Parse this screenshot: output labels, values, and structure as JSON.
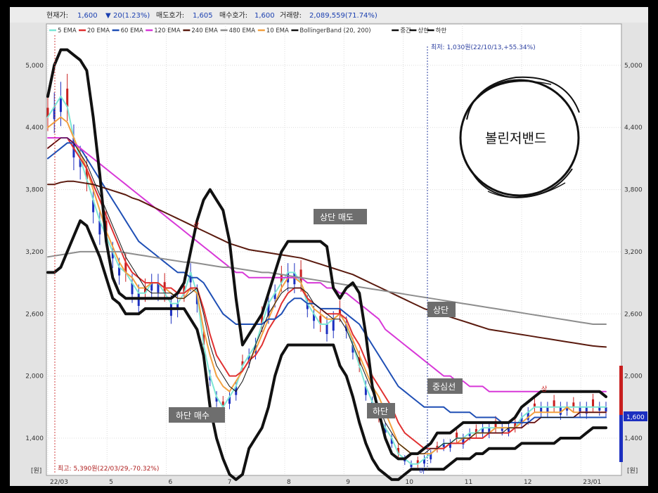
{
  "header": {
    "price_label": "현재가:",
    "price_value": "1,600",
    "change_value": "20(1.23%)",
    "ask_label": "매도호가:",
    "ask_value": "1,605",
    "bid_label": "매수호가:",
    "bid_value": "1,600",
    "volume_label": "거래량:",
    "volume_value": "2,089,559(71.74%)"
  },
  "legend": [
    {
      "name": "5 EMA",
      "color": "#7de7d6"
    },
    {
      "name": "20 EMA",
      "color": "#e03030"
    },
    {
      "name": "60 EMA",
      "color": "#1f4fb5"
    },
    {
      "name": "120 EMA",
      "color": "#d838d8"
    },
    {
      "name": "240 EMA",
      "color": "#5a1a0e"
    },
    {
      "name": "480 EMA",
      "color": "#8d8d8d"
    },
    {
      "name": "10 EMA",
      "color": "#f2a040"
    },
    {
      "name": "BollingerBand (20, 200)",
      "color": "#111111"
    },
    {
      "name": "중간",
      "color": "#111111"
    },
    {
      "name": "상한",
      "color": "#111111"
    },
    {
      "name": "하한",
      "color": "#111111"
    }
  ],
  "annotations": {
    "low_label": "최저: 1,030원(22/10/13,+55.34%)",
    "high_label": "최고: 5,390원(22/03/29,-70.32%)",
    "upper_sell": "상단 매도",
    "lower_buy": "하단 매수",
    "upper": "상단",
    "lower": "하단",
    "centerline": "중심선",
    "badge": "볼린저밴드",
    "current_price_tag": "1,600",
    "unit_left": "[원]",
    "unit_right": "[원]",
    "peak_marker": "상",
    "trough_marker": "하"
  },
  "chart_data": {
    "type": "line",
    "title": "",
    "x_ticks": [
      "22/03",
      "5",
      "6",
      "7",
      "8",
      "9",
      "10",
      "11",
      "12",
      "23/01"
    ],
    "y_ticks": [
      1400,
      2000,
      2600,
      3200,
      3800,
      4400,
      5000
    ],
    "y_tick_labels": [
      "1,400",
      "2,000",
      "2,600",
      "3,200",
      "3,800",
      "4,400",
      "5,000"
    ],
    "ylim": [
      1040,
      5400
    ],
    "x": [
      0,
      0.5,
      1,
      1.5,
      2,
      2.5,
      3,
      3.5,
      4,
      4.5,
      5,
      5.5,
      6,
      6.5,
      7,
      7.5,
      8,
      8.5,
      9,
      9.5,
      10,
      10.5,
      11,
      11.5,
      12,
      12.5,
      13,
      13.5,
      14,
      14.5,
      15,
      15.5,
      16,
      16.5,
      17,
      17.5,
      18,
      18.5,
      19,
      19.5,
      20,
      20.5,
      21,
      21.5,
      22,
      22.5,
      23,
      23.5,
      24,
      24.5,
      25,
      25.5,
      26,
      26.5,
      27,
      27.5,
      28,
      28.5,
      29,
      29.5,
      30,
      30.5,
      31,
      31.5,
      32,
      32.5,
      33,
      33.5,
      34,
      34.5,
      35,
      35.5,
      36,
      36.5,
      37,
      37.5,
      38,
      38.5,
      39,
      39.5,
      40,
      40.5,
      41,
      41.5,
      42,
      42.5,
      43
    ],
    "grid": true,
    "series": [
      {
        "name": "5 EMA",
        "color": "#7de7d6",
        "values": [
          4500,
          4600,
          4700,
          4600,
          4300,
          4100,
          3900,
          3700,
          3500,
          3350,
          3200,
          3050,
          3000,
          2900,
          2800,
          2800,
          2900,
          2900,
          2800,
          2700,
          2700,
          2800,
          3000,
          2800,
          2300,
          2000,
          1800,
          1700,
          1800,
          1900,
          2100,
          2200,
          2300,
          2500,
          2700,
          2800,
          2900,
          3000,
          3000,
          2900,
          2700,
          2600,
          2500,
          2500,
          2550,
          2600,
          2500,
          2300,
          2100,
          1900,
          1750,
          1600,
          1500,
          1400,
          1250,
          1200,
          1150,
          1150,
          1200,
          1250,
          1300,
          1350,
          1350,
          1400,
          1400,
          1450,
          1450,
          1500,
          1500,
          1500,
          1500,
          1500,
          1500,
          1600,
          1650,
          1700,
          1700,
          1700,
          1700,
          1700,
          1700,
          1700,
          1700,
          1700,
          1700,
          1700,
          1700
        ]
      },
      {
        "name": "10 EMA",
        "color": "#f2a040",
        "values": [
          4400,
          4450,
          4500,
          4450,
          4300,
          4150,
          4000,
          3800,
          3600,
          3400,
          3250,
          3100,
          3000,
          2950,
          2850,
          2850,
          2900,
          2900,
          2850,
          2800,
          2750,
          2750,
          2850,
          2800,
          2450,
          2200,
          2000,
          1900,
          1850,
          1950,
          2050,
          2150,
          2250,
          2400,
          2550,
          2700,
          2850,
          2950,
          2950,
          2900,
          2750,
          2650,
          2600,
          2550,
          2550,
          2600,
          2500,
          2350,
          2200,
          2050,
          1900,
          1800,
          1650,
          1500,
          1350,
          1300,
          1250,
          1250,
          1250,
          1250,
          1300,
          1300,
          1350,
          1350,
          1400,
          1400,
          1450,
          1450,
          1450,
          1500,
          1500,
          1500,
          1500,
          1550,
          1600,
          1650,
          1650,
          1650,
          1650,
          1650,
          1700,
          1650,
          1650,
          1650,
          1650,
          1650,
          1650
        ]
      },
      {
        "name": "20 EMA",
        "color": "#e03030",
        "values": [
          4200,
          4250,
          4300,
          4300,
          4200,
          4100,
          4000,
          3850,
          3700,
          3550,
          3400,
          3250,
          3100,
          3000,
          2950,
          2900,
          2900,
          2900,
          2850,
          2850,
          2800,
          2800,
          2850,
          2850,
          2650,
          2400,
          2200,
          2100,
          2000,
          2000,
          2050,
          2150,
          2200,
          2300,
          2450,
          2550,
          2700,
          2800,
          2850,
          2850,
          2750,
          2700,
          2650,
          2600,
          2600,
          2600,
          2550,
          2400,
          2300,
          2150,
          2000,
          1900,
          1800,
          1700,
          1550,
          1450,
          1400,
          1350,
          1300,
          1300,
          1300,
          1300,
          1350,
          1350,
          1350,
          1400,
          1400,
          1400,
          1450,
          1450,
          1450,
          1450,
          1500,
          1500,
          1550,
          1550,
          1600,
          1600,
          1600,
          1600,
          1600,
          1600,
          1650,
          1650,
          1650,
          1650,
          1650
        ]
      },
      {
        "name": "60 EMA",
        "color": "#1f4fb5",
        "values": [
          4100,
          4150,
          4200,
          4250,
          4250,
          4200,
          4100,
          4000,
          3900,
          3800,
          3700,
          3600,
          3500,
          3400,
          3300,
          3250,
          3200,
          3150,
          3100,
          3050,
          3000,
          3000,
          2950,
          2950,
          2900,
          2800,
          2700,
          2600,
          2550,
          2500,
          2500,
          2500,
          2500,
          2500,
          2550,
          2550,
          2600,
          2700,
          2750,
          2750,
          2700,
          2700,
          2650,
          2650,
          2650,
          2650,
          2600,
          2550,
          2500,
          2400,
          2300,
          2200,
          2100,
          2000,
          1900,
          1850,
          1800,
          1750,
          1700,
          1700,
          1700,
          1700,
          1650,
          1650,
          1650,
          1650,
          1600,
          1600,
          1600,
          1600,
          1550,
          1550,
          1550,
          1550,
          1550,
          1600,
          1600,
          1600,
          1600,
          1600,
          1600,
          1600,
          1600,
          1600,
          1600,
          1600,
          1600
        ]
      },
      {
        "name": "120 EMA",
        "color": "#d838d8",
        "values": [
          4300,
          4300,
          4300,
          4300,
          4250,
          4200,
          4150,
          4100,
          4050,
          4000,
          3950,
          3900,
          3850,
          3800,
          3750,
          3700,
          3650,
          3600,
          3550,
          3500,
          3450,
          3400,
          3350,
          3300,
          3250,
          3200,
          3150,
          3100,
          3050,
          3000,
          3000,
          2950,
          2950,
          2950,
          2950,
          2950,
          2950,
          2950,
          2950,
          2950,
          2900,
          2900,
          2900,
          2850,
          2850,
          2800,
          2800,
          2750,
          2700,
          2650,
          2600,
          2550,
          2450,
          2400,
          2350,
          2300,
          2250,
          2200,
          2150,
          2100,
          2050,
          2000,
          2000,
          1950,
          1950,
          1900,
          1900,
          1900,
          1850,
          1850,
          1850,
          1850,
          1850,
          1850,
          1850,
          1850,
          1850,
          1850,
          1850,
          1850,
          1850,
          1850,
          1850,
          1850,
          1850,
          1850,
          1850
        ]
      },
      {
        "name": "240 EMA",
        "color": "#5a1a0e",
        "values": [
          3850,
          3850,
          3870,
          3880,
          3880,
          3870,
          3860,
          3850,
          3830,
          3810,
          3790,
          3770,
          3750,
          3720,
          3700,
          3670,
          3640,
          3610,
          3580,
          3550,
          3520,
          3490,
          3460,
          3430,
          3400,
          3370,
          3340,
          3310,
          3280,
          3260,
          3240,
          3220,
          3210,
          3200,
          3190,
          3180,
          3170,
          3160,
          3150,
          3140,
          3120,
          3100,
          3080,
          3060,
          3040,
          3020,
          3000,
          2980,
          2950,
          2920,
          2890,
          2860,
          2830,
          2800,
          2770,
          2740,
          2710,
          2680,
          2650,
          2630,
          2610,
          2590,
          2570,
          2550,
          2530,
          2510,
          2490,
          2470,
          2450,
          2440,
          2430,
          2420,
          2410,
          2400,
          2390,
          2380,
          2370,
          2360,
          2350,
          2340,
          2330,
          2320,
          2310,
          2300,
          2290,
          2285,
          2280
        ]
      },
      {
        "name": "480 EMA",
        "color": "#8d8d8d",
        "values": [
          3150,
          3160,
          3170,
          3180,
          3190,
          3200,
          3200,
          3200,
          3200,
          3200,
          3200,
          3200,
          3190,
          3180,
          3170,
          3160,
          3150,
          3140,
          3130,
          3120,
          3110,
          3100,
          3100,
          3090,
          3080,
          3070,
          3060,
          3050,
          3050,
          3040,
          3030,
          3020,
          3010,
          3000,
          3000,
          2990,
          2980,
          2970,
          2960,
          2950,
          2940,
          2930,
          2920,
          2910,
          2900,
          2890,
          2880,
          2870,
          2860,
          2850,
          2840,
          2830,
          2820,
          2810,
          2800,
          2790,
          2780,
          2770,
          2760,
          2750,
          2740,
          2730,
          2720,
          2710,
          2700,
          2690,
          2680,
          2670,
          2660,
          2650,
          2640,
          2630,
          2620,
          2610,
          2600,
          2590,
          2580,
          2570,
          2560,
          2550,
          2540,
          2530,
          2520,
          2510,
          2500,
          2500,
          2500
        ]
      },
      {
        "name": "중간",
        "color": "#111111",
        "values": [
          4200,
          4250,
          4300,
          4300,
          4250,
          4150,
          4050,
          3900,
          3750,
          3600,
          3450,
          3300,
          3150,
          3050,
          2950,
          2850,
          2800,
          2800,
          2800,
          2800,
          2750,
          2750,
          2800,
          2850,
          2600,
          2300,
          2100,
          2000,
          1900,
          1850,
          1950,
          2100,
          2300,
          2450,
          2600,
          2700,
          2800,
          2850,
          2850,
          2850,
          2800,
          2700,
          2650,
          2600,
          2550,
          2550,
          2450,
          2300,
          2150,
          2000,
          1850,
          1700,
          1550,
          1450,
          1350,
          1300,
          1250,
          1250,
          1250,
          1300,
          1300,
          1350,
          1350,
          1400,
          1400,
          1400,
          1450,
          1450,
          1450,
          1450,
          1450,
          1500,
          1500,
          1500,
          1550,
          1550,
          1600,
          1600,
          1600,
          1600,
          1600,
          1600,
          1650,
          1650,
          1650,
          1650,
          1650
        ]
      },
      {
        "name": "상한",
        "color": "#111111",
        "values": [
          4700,
          5000,
          5150,
          5150,
          5100,
          5050,
          4950,
          4500,
          3950,
          3300,
          2950,
          2800,
          2750,
          2750,
          2750,
          2750,
          2750,
          2750,
          2750,
          2750,
          2800,
          2900,
          3200,
          3500,
          3700,
          3800,
          3700,
          3600,
          3300,
          2750,
          2300,
          2400,
          2500,
          2600,
          2800,
          3000,
          3200,
          3300,
          3300,
          3300,
          3300,
          3300,
          3300,
          3250,
          2850,
          2750,
          2850,
          2900,
          2800,
          2400,
          1900,
          1650,
          1400,
          1250,
          1200,
          1200,
          1250,
          1250,
          1300,
          1350,
          1450,
          1450,
          1450,
          1500,
          1550,
          1550,
          1550,
          1550,
          1550,
          1550,
          1550,
          1550,
          1600,
          1700,
          1750,
          1800,
          1850,
          1850,
          1850,
          1850,
          1850,
          1850,
          1850,
          1850,
          1850,
          1850,
          1800
        ]
      },
      {
        "name": "하한",
        "color": "#111111",
        "values": [
          3000,
          3000,
          3050,
          3200,
          3350,
          3500,
          3450,
          3300,
          3150,
          2950,
          2750,
          2700,
          2600,
          2600,
          2600,
          2650,
          2650,
          2650,
          2650,
          2650,
          2650,
          2650,
          2550,
          2450,
          2200,
          1700,
          1400,
          1200,
          1050,
          1000,
          1050,
          1300,
          1400,
          1500,
          1700,
          2000,
          2200,
          2300,
          2300,
          2300,
          2300,
          2300,
          2300,
          2300,
          2300,
          2100,
          2000,
          1800,
          1550,
          1350,
          1200,
          1100,
          1050,
          1000,
          1000,
          1050,
          1100,
          1100,
          1100,
          1100,
          1100,
          1100,
          1150,
          1200,
          1200,
          1200,
          1250,
          1250,
          1300,
          1300,
          1300,
          1300,
          1300,
          1350,
          1350,
          1350,
          1350,
          1350,
          1350,
          1400,
          1400,
          1400,
          1400,
          1450,
          1500,
          1500,
          1500
        ]
      }
    ]
  }
}
